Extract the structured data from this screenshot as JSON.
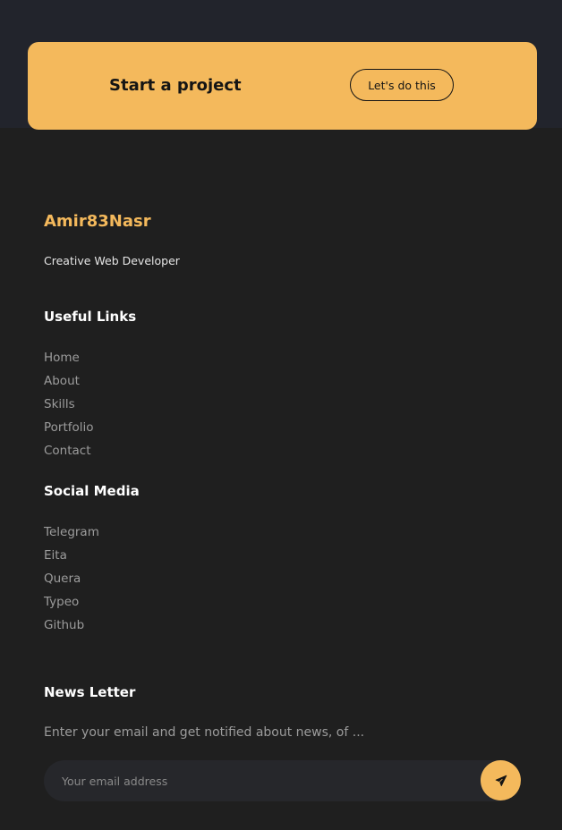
{
  "cta": {
    "title": "Start a project",
    "button_label": "Let's do this"
  },
  "footer": {
    "brand": "Amir83Nasr",
    "tagline": "Creative Web Developer",
    "useful_links": {
      "title": "Useful Links",
      "items": [
        "Home",
        "About",
        "Skills",
        "Portfolio",
        "Contact"
      ]
    },
    "social_media": {
      "title": "Social Media",
      "items": [
        "Telegram",
        "Eita",
        "Quera",
        "Typeo",
        "Github"
      ]
    },
    "newsletter": {
      "title": "News Letter",
      "description": "Enter your email and get notified about news, of ...",
      "email_placeholder": "Your email address",
      "send_icon": "paper-plane-icon"
    }
  },
  "colors": {
    "accent": "#f4b95c",
    "page_background": "#1f1f1f",
    "top_band_background": "#22242c",
    "input_background": "#26272b",
    "link_text": "#9c9c9c"
  }
}
